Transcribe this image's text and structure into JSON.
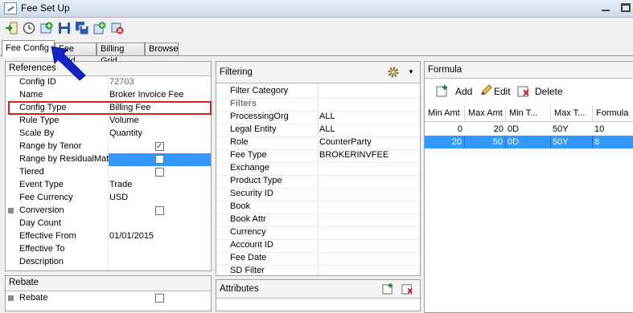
{
  "window": {
    "title": "Fee Set Up"
  },
  "toolbar": {
    "icons": [
      "import-icon",
      "clock-icon",
      "add-icon",
      "save-icon",
      "save-all-icon",
      "new-icon",
      "delete-icon"
    ]
  },
  "tabs": [
    {
      "label": "Fee Config",
      "active": true
    },
    {
      "label": "Fee Grid",
      "active": false
    },
    {
      "label": "Billing Grid",
      "active": false
    },
    {
      "label": "Browse",
      "active": false
    }
  ],
  "references": {
    "header": "References",
    "rows": [
      {
        "label": "Config ID",
        "value": "72703",
        "value_color": "#666666"
      },
      {
        "label": "Name",
        "value": "Broker Invoice Fee"
      },
      {
        "label": "Config Type",
        "value": "Billing Fee",
        "highlight_box": true
      },
      {
        "label": "Rule Type",
        "value": "Volume"
      },
      {
        "label": "Scale By",
        "value": "Quantity"
      },
      {
        "label": "Range by Tenor",
        "checkbox": true,
        "checked": true
      },
      {
        "label": "Range by ResidualMat",
        "checkbox": true,
        "checked": false,
        "selected": true
      },
      {
        "label": "Tiered",
        "checkbox": true,
        "checked": false
      },
      {
        "label": "Event Type",
        "value": "Trade"
      },
      {
        "label": "Fee Currency",
        "value": "USD"
      },
      {
        "label": "Conversion",
        "checkbox": true,
        "checked": false,
        "expandable": true
      },
      {
        "label": "Day Count",
        "value": ""
      },
      {
        "label": "Effective From",
        "value": "01/01/2015"
      },
      {
        "label": "Effective To",
        "value": ""
      },
      {
        "label": "Description",
        "value": ""
      }
    ]
  },
  "rebate": {
    "header": "Rebate",
    "rows": [
      {
        "label": "Rebate",
        "checkbox": true,
        "checked": false,
        "expandable": true
      }
    ]
  },
  "filtering": {
    "header": "Filtering",
    "rows": [
      {
        "label": "Filter Category",
        "value": ""
      },
      {
        "label": "Filters",
        "value": "",
        "section": true
      },
      {
        "label": "ProcessingOrg",
        "value": "ALL"
      },
      {
        "label": "Legal Entity",
        "value": "ALL"
      },
      {
        "label": "Role",
        "value": "CounterParty"
      },
      {
        "label": "Fee Type",
        "value": "BROKERINVFEE"
      },
      {
        "label": "Exchange",
        "value": ""
      },
      {
        "label": "Product Type",
        "value": ""
      },
      {
        "label": "Security ID",
        "value": ""
      },
      {
        "label": "Book",
        "value": ""
      },
      {
        "label": "Book Attr",
        "value": ""
      },
      {
        "label": "Currency",
        "value": ""
      },
      {
        "label": "Account ID",
        "value": ""
      },
      {
        "label": "Fee Date",
        "value": ""
      },
      {
        "label": "SD Filter",
        "value": ""
      }
    ]
  },
  "attributes": {
    "header": "Attributes"
  },
  "formula": {
    "header": "Formula",
    "add_label": "Add",
    "edit_label": "Edit",
    "delete_label": "Delete",
    "columns": [
      "Min Amt",
      "Max Amt",
      "Min T...",
      "Max T...",
      "Formula"
    ],
    "rows": [
      {
        "cells": [
          "0",
          "20",
          "0D",
          "50Y",
          "10"
        ],
        "selected": false
      },
      {
        "cells": [
          "20",
          "50",
          "0D",
          "50Y",
          "8"
        ],
        "selected": true
      }
    ]
  },
  "colors": {
    "selection": "#3399ff",
    "highlight_box": "#d42020",
    "pointer_arrow": "#1024c8"
  }
}
